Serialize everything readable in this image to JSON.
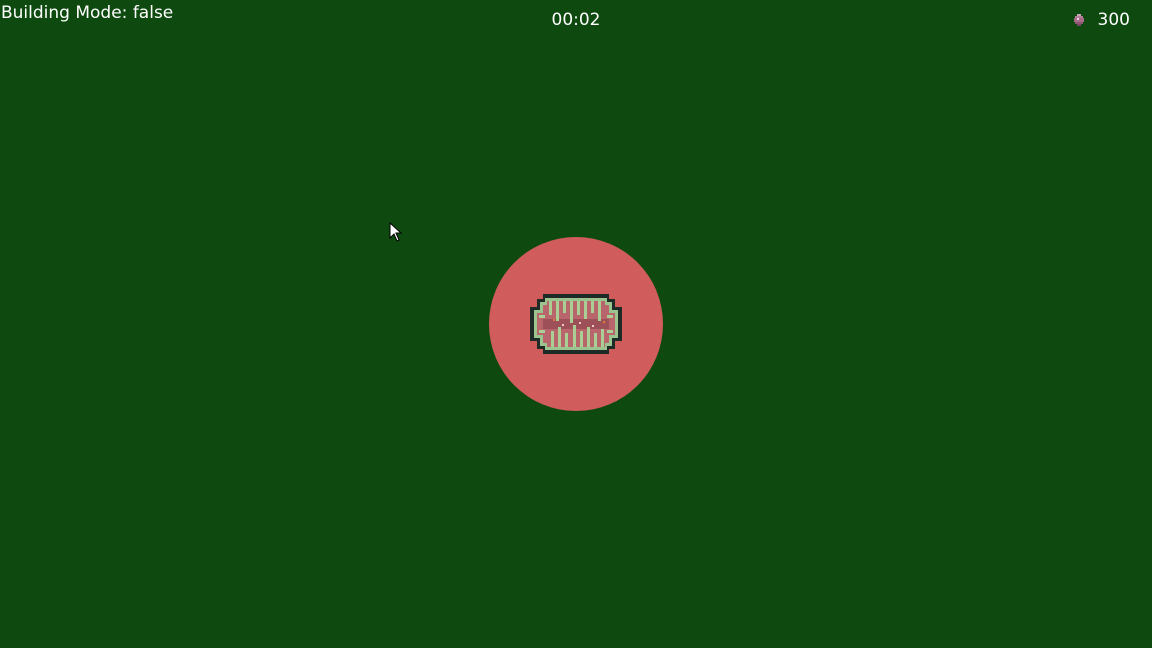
{
  "hud": {
    "building_mode_text": "Building Mode: false",
    "timer": "00:02",
    "resource_count": "300",
    "resource_icon": "gem-icon"
  },
  "world": {
    "background_color": "#0e4a0f",
    "base_range_color": "#d15c5c",
    "base_icon": "base-structure"
  }
}
